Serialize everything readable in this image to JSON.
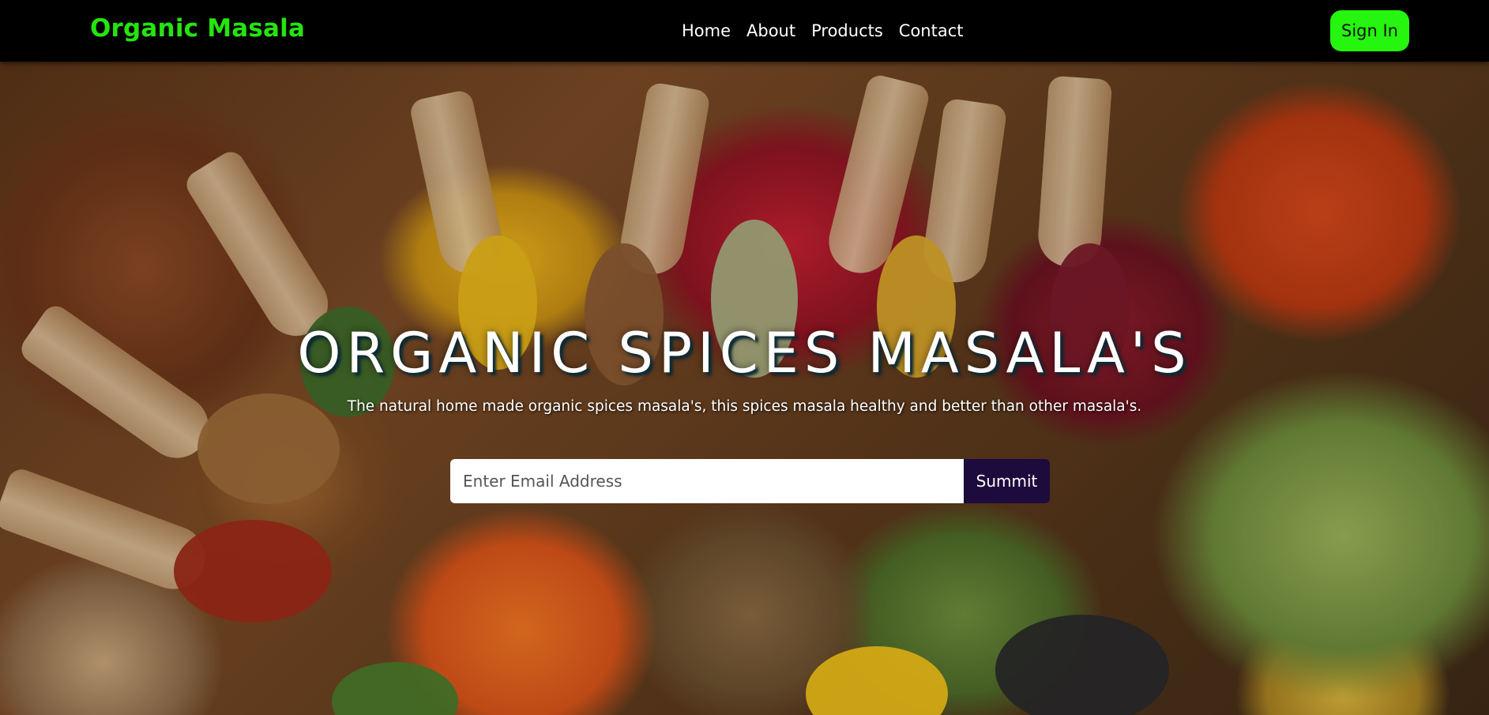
{
  "header": {
    "brand": "Organic Masala",
    "nav": [
      {
        "label": "Home"
      },
      {
        "label": "About"
      },
      {
        "label": "Products"
      },
      {
        "label": "Contact"
      }
    ],
    "signin_label": "Sign In"
  },
  "hero": {
    "title": "ORGANIC SPICES MASALA'S",
    "subtitle": "The natural home made organic spices masala's, this spices masala healthy and better than other masala's.",
    "email_placeholder": "Enter Email Address",
    "email_value": "",
    "submit_label": "Summit"
  },
  "colors": {
    "brand": "#25e40f",
    "signin_bg": "#25f50f",
    "submit_bg": "#1e0b3d",
    "navbar_bg": "#000000"
  }
}
